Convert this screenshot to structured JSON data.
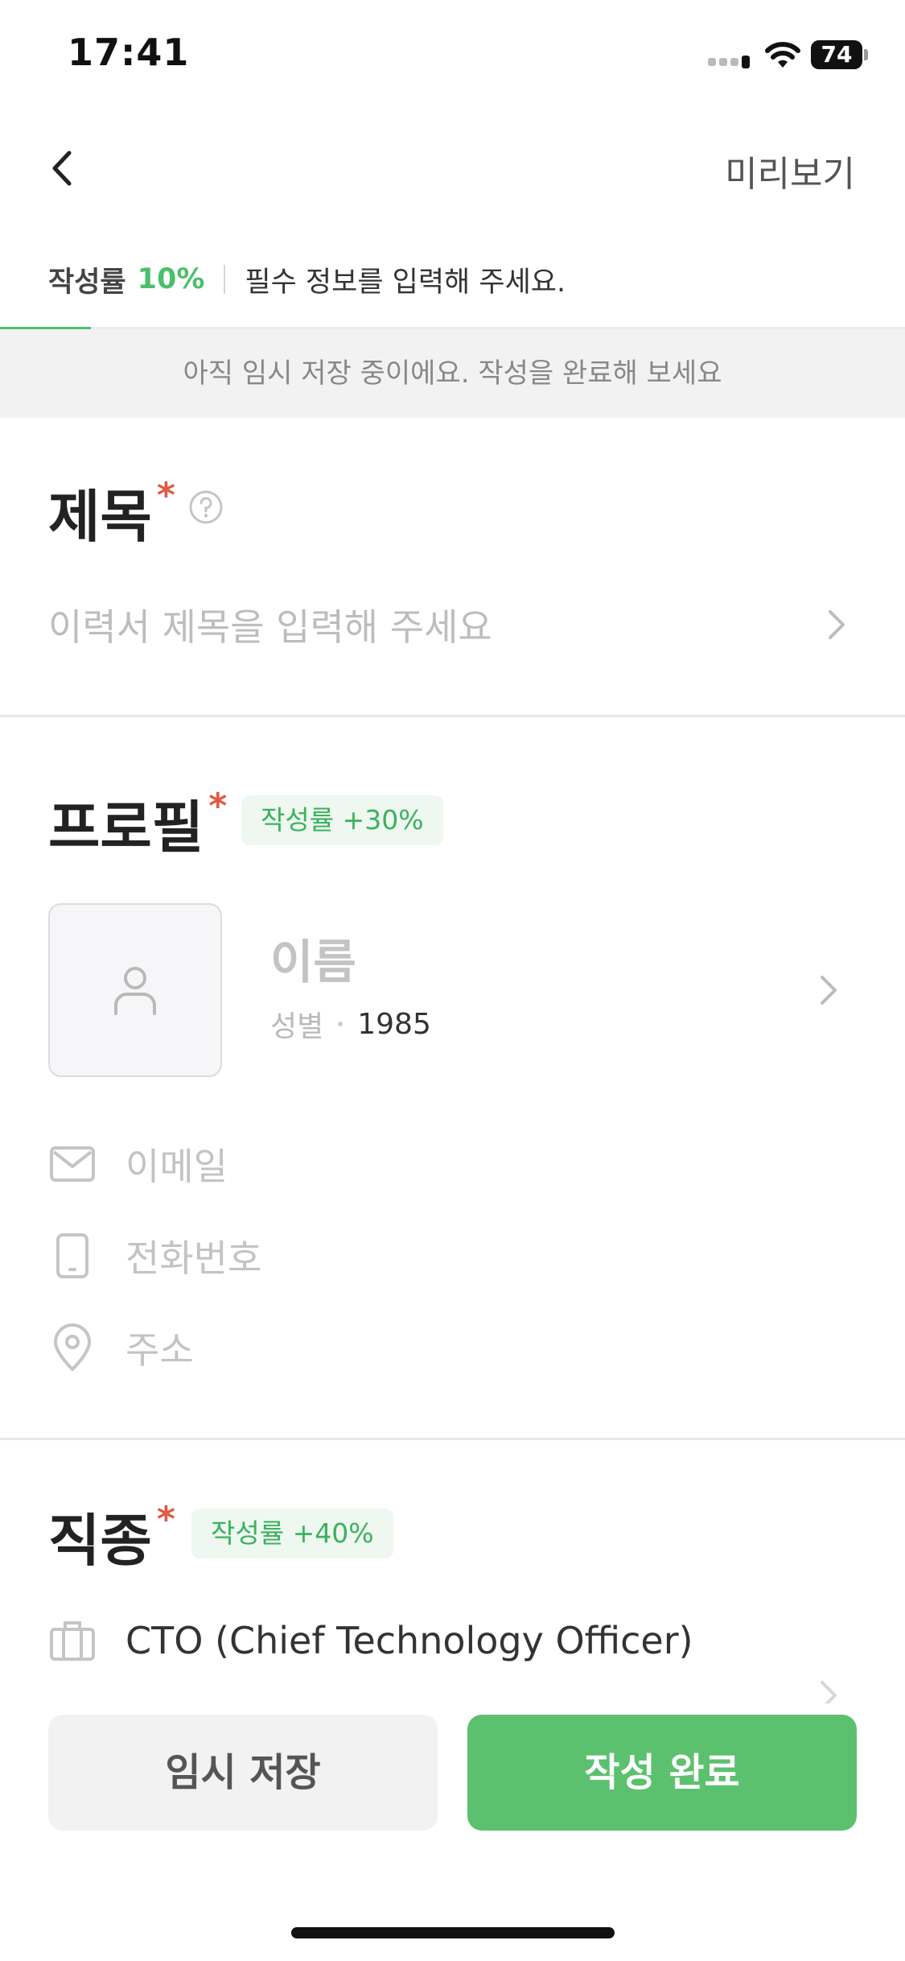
{
  "status_bar": {
    "time": "17:41",
    "battery": "74"
  },
  "nav": {
    "preview_label": "미리보기"
  },
  "progress": {
    "label": "작성률",
    "percent_text": "10%",
    "hint": "필수 정보를 입력해 주세요.",
    "fraction": 0.1
  },
  "banner": {
    "text": "아직 임시 저장 중이에요. 작성을 완료해 보세요"
  },
  "title_section": {
    "heading": "제목",
    "required_mark": "*",
    "placeholder": "이력서 제목을 입력해 주세요"
  },
  "profile_section": {
    "heading": "프로필",
    "required_mark": "*",
    "badge": "작성률 +30%",
    "name_placeholder": "이름",
    "gender_placeholder": "성별",
    "birth_year": "1985",
    "email_placeholder": "이메일",
    "phone_placeholder": "전화번호",
    "address_placeholder": "주소"
  },
  "job_section": {
    "heading": "직종",
    "required_mark": "*",
    "badge": "작성률 +40%",
    "job_value": "CTO (Chief Technology Officer)"
  },
  "buttons": {
    "draft_label": "임시 저장",
    "complete_label": "작성 완료"
  },
  "colors": {
    "accent": "#5cc16e",
    "progress": "#4bbf6b",
    "required": "#e05a45"
  },
  "icons": [
    "chevron-left-icon",
    "help-icon",
    "chevron-right-icon",
    "person-icon",
    "mail-icon",
    "phone-icon",
    "location-icon",
    "briefcase-icon"
  ]
}
